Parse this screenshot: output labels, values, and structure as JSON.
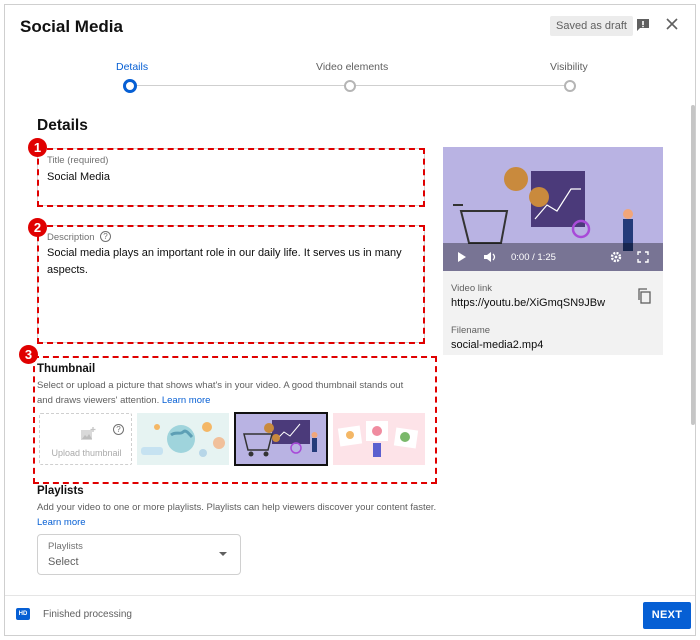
{
  "header": {
    "title": "Social Media",
    "draft_status": "Saved as draft",
    "feedback_icon": "feedback-icon",
    "close_icon": "close-icon"
  },
  "stepper": {
    "steps": [
      {
        "label": "Details",
        "active": true
      },
      {
        "label": "Video elements",
        "active": false
      },
      {
        "label": "Visibility",
        "active": false
      }
    ]
  },
  "details": {
    "heading": "Details",
    "title_field": {
      "label": "Title (required)",
      "value": "Social Media"
    },
    "description_field": {
      "label": "Description",
      "value": "Social media plays an important role in our daily life. It serves us in many aspects."
    },
    "markers": [
      "1",
      "2",
      "3"
    ]
  },
  "thumbnail": {
    "heading": "Thumbnail",
    "description": "Select or upload a picture that shows what's in your video. A good thumbnail stands out and draws viewers' attention.",
    "learn_more": "Learn more",
    "upload_label": "Upload thumbnail"
  },
  "playlists": {
    "heading": "Playlists",
    "description": "Add your video to one or more playlists. Playlists can help viewers discover your content faster.",
    "learn_more": "Learn more",
    "select_label": "Playlists",
    "select_value": "Select"
  },
  "video_panel": {
    "time": "0:00 / 1:25",
    "video_link_label": "Video link",
    "video_link": "https://youtu.be/XiGmqSN9JBw",
    "filename_label": "Filename",
    "filename": "social-media2.mp4"
  },
  "footer": {
    "badge": "HD",
    "status": "Finished processing",
    "next_label": "NEXT"
  },
  "colors": {
    "accent": "#065fd4",
    "annotation": "#e00000"
  }
}
